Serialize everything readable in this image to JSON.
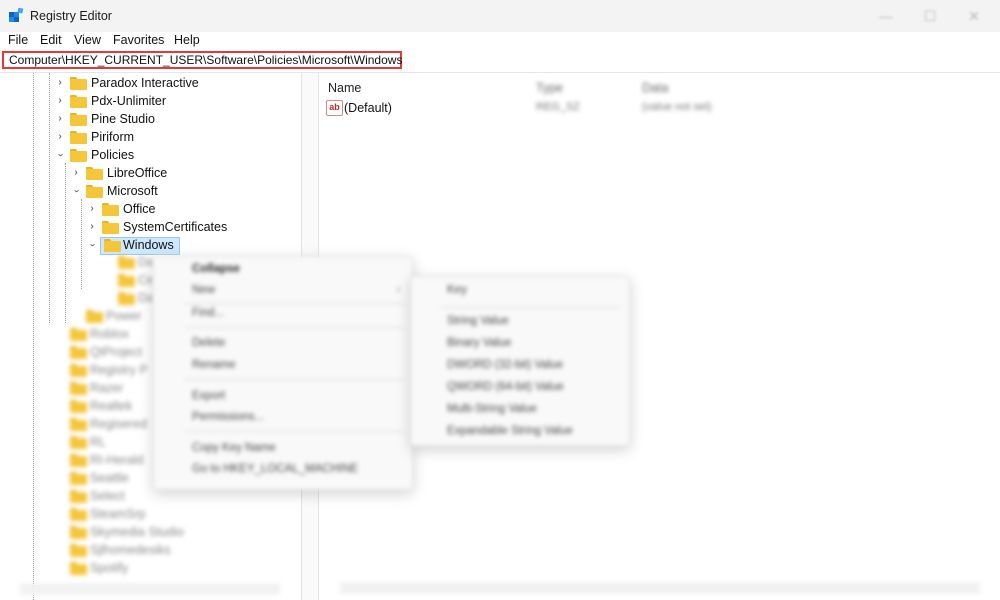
{
  "window": {
    "title": "Registry Editor",
    "controls": [
      "—",
      "☐",
      "✕"
    ]
  },
  "menubar": [
    "File",
    "Edit",
    "View",
    "Favorites",
    "Help"
  ],
  "address": "Computer\\HKEY_CURRENT_USER\\Software\\Policies\\Microsoft\\Windows",
  "tree": {
    "items": [
      {
        "label": "Paradox Interactive",
        "expanded": false
      },
      {
        "label": "Pdx-Unlimiter",
        "expanded": false
      },
      {
        "label": "Pine Studio",
        "expanded": false
      },
      {
        "label": "Piriform",
        "expanded": false
      },
      {
        "label": "Policies",
        "expanded": true
      },
      {
        "label": "LibreOffice",
        "expanded": false
      },
      {
        "label": "Microsoft",
        "expanded": true
      },
      {
        "label": "Office",
        "expanded": false
      },
      {
        "label": "SystemCertificates",
        "expanded": false
      },
      {
        "label": "Windows",
        "expanded": true,
        "selected": true
      }
    ],
    "blurred_items": [
      "Da",
      "Ce",
      "Da",
      "Power",
      "Roblox",
      "QtProject",
      "Registry P",
      "Razer",
      "Realtek",
      "Regisered",
      "RL",
      "RI-Herald",
      "Seattle",
      "Select",
      "SteamSrp",
      "Skymedia Studio",
      "Sjlhomedesiks",
      "Spotify"
    ]
  },
  "list": {
    "columns": {
      "name": "Name",
      "type": "Type",
      "data": "Data"
    },
    "rows": [
      {
        "icon": "ab",
        "name": "(Default)",
        "type": "REG_SZ",
        "data": "(value not set)"
      }
    ]
  },
  "context_menu": {
    "items": [
      "Collapse",
      "New",
      "Find...",
      "Delete",
      "Rename",
      "Export",
      "Permissions...",
      "Copy Key Name",
      "Go to HKEY_LOCAL_MACHINE"
    ],
    "arrow": "›"
  },
  "submenu": {
    "items": [
      "Key",
      "String Value",
      "Binary Value",
      "DWORD (32-bit) Value",
      "QWORD (64-bit) Value",
      "Multi-String Value",
      "Expandable String Value"
    ]
  },
  "icons": {
    "app": "registry-icon",
    "folder": "folder-icon",
    "value": "string-value-icon"
  },
  "colors": {
    "address_highlight": "#e53935",
    "selection": "#cde8ff",
    "folder": "#f5c63a"
  }
}
